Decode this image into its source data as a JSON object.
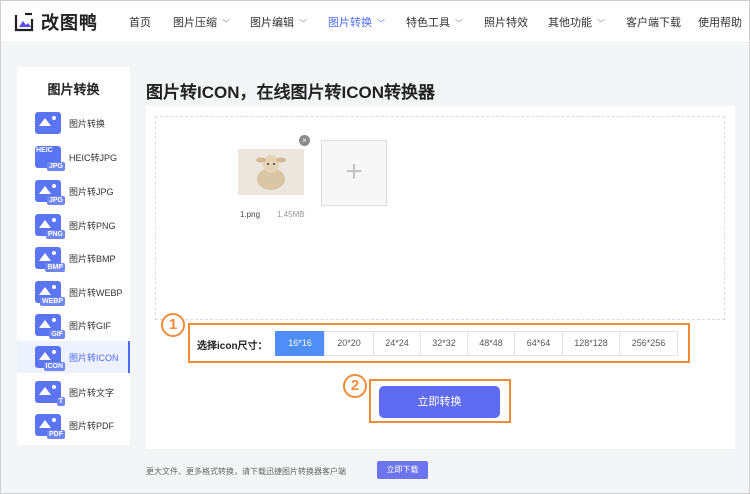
{
  "brand": {
    "name": "改图鸭"
  },
  "nav": [
    {
      "label": "首页",
      "has_menu": false
    },
    {
      "label": "图片压缩",
      "has_menu": true
    },
    {
      "label": "图片编辑",
      "has_menu": true
    },
    {
      "label": "图片转换",
      "has_menu": true,
      "active": true
    },
    {
      "label": "特色工具",
      "has_menu": true
    },
    {
      "label": "照片特效",
      "has_menu": false
    },
    {
      "label": "其他功能",
      "has_menu": true
    },
    {
      "label": "客户端下载",
      "has_menu": false
    },
    {
      "label": "使用帮助",
      "has_menu": false
    }
  ],
  "sidebar": {
    "title": "图片转换",
    "items": [
      {
        "label": "图片转换",
        "tag": ""
      },
      {
        "label": "HEIC转JPG",
        "tag": "JPG"
      },
      {
        "label": "图片转JPG",
        "tag": "JPG"
      },
      {
        "label": "图片转PNG",
        "tag": "PNG"
      },
      {
        "label": "图片转BMP",
        "tag": "BMP"
      },
      {
        "label": "图片转WEBP",
        "tag": "WEBP"
      },
      {
        "label": "图片转GIF",
        "tag": "GIF"
      },
      {
        "label": "图片转ICON",
        "tag": "ICON",
        "active": true
      },
      {
        "label": "图片转文字",
        "tag": "T"
      },
      {
        "label": "图片转PDF",
        "tag": "PDF"
      }
    ],
    "heic_badge": "HEIC"
  },
  "main": {
    "title": "图片转ICON，在线图片转ICON转换器",
    "file": {
      "name": "1.png",
      "size": "1.45MB"
    },
    "add_symbol": "+",
    "close_symbol": "×"
  },
  "size_select": {
    "step": "1",
    "label": "选择icon尺寸：",
    "options": [
      "16*16",
      "20*20",
      "24*24",
      "32*32",
      "48*48",
      "64*64",
      "128*128",
      "256*256"
    ],
    "selected_index": 0
  },
  "convert": {
    "step": "2",
    "label": "立即转换"
  },
  "footer": {
    "notice": "更大文件、更多格式转换，请下载迅捷图片转换器客户端",
    "download_label": "立即下载"
  },
  "colors": {
    "accent": "#4f6bf5",
    "highlight": "#f08b3a",
    "selected": "#4f8ef7",
    "button": "#5f6cf2"
  }
}
